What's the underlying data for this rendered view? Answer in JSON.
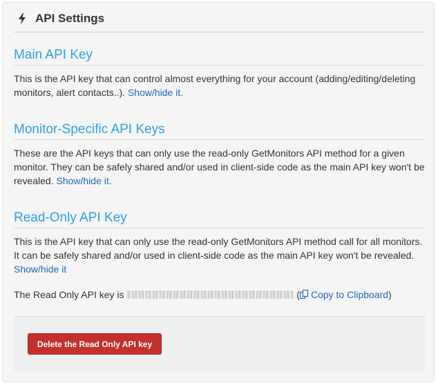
{
  "header": {
    "icon": "bolt-icon",
    "title": "API Settings"
  },
  "sections": {
    "main_key": {
      "title": "Main API Key",
      "text": "This is the API key that can control almost everything for your account (adding/editing/deleting monitors, alert contacts..). ",
      "link": "Show/hide it."
    },
    "monitor_keys": {
      "title": "Monitor-Specific API Keys",
      "text": "These are the API keys that can only use the read-only GetMonitors API method for a given monitor. They can be safely shared and/or used in client-side code as the main API key won't be revealed. ",
      "link": "Show/hide it."
    },
    "readonly_key": {
      "title": "Read-Only API Key",
      "text": "This is the API key that can only use the read-only GetMonitors API method call for all monitors. It can be safely shared and/or used in client-side code as the main API key won't be revealed.",
      "link": "Show/hide it"
    }
  },
  "readonly_line": {
    "prefix": "The Read Only API key is ",
    "open_paren": " (",
    "copy_icon": "copy-icon",
    "copy_label": "Copy to Clipboard",
    "close_paren": ")"
  },
  "actions": {
    "delete_label": "Delete the Read Only API key"
  },
  "colors": {
    "section_title": "#2e9fe6",
    "link": "#1f66b8",
    "danger": "#c4302b"
  }
}
